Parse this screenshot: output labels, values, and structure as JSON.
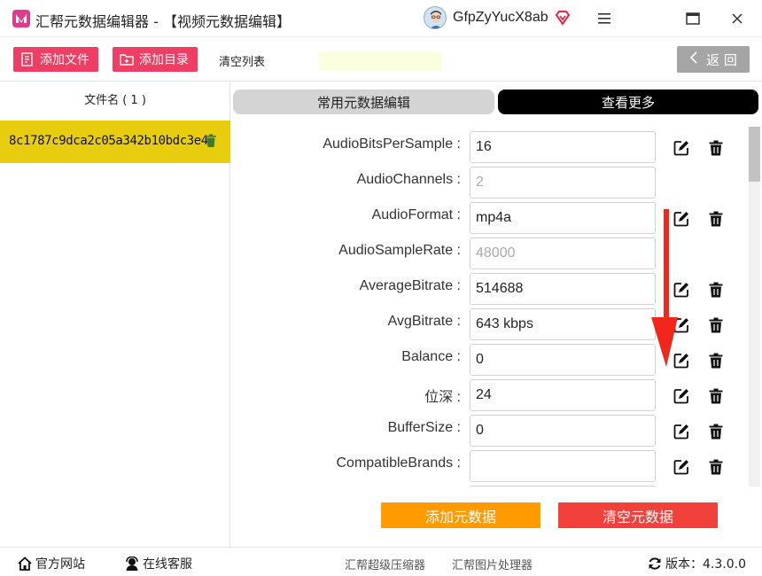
{
  "titlebar": {
    "title": "汇帮元数据编辑器 - 【视频元数据编辑】",
    "username": "GfpZyYucX8ab",
    "menu_icon": "menu-icon",
    "maximize_icon": "maximize-icon",
    "close_icon": "close-icon"
  },
  "toolbar": {
    "add_file": "添加文件",
    "add_dir": "添加目录",
    "clear_list": "清空列表",
    "back": "返 回"
  },
  "file_panel": {
    "header": "文件名 ( 1 )",
    "files": [
      {
        "name": "8c1787c9dca2c05a342b10bdc3e4"
      }
    ]
  },
  "tabs": {
    "common": "常用元数据编辑",
    "more": "查看更多"
  },
  "metadata": [
    {
      "label": "AudioBitsPerSample :",
      "value": "16",
      "editable": true
    },
    {
      "label": "AudioChannels :",
      "value": "2",
      "editable": false
    },
    {
      "label": "AudioFormat :",
      "value": "mp4a",
      "editable": true
    },
    {
      "label": "AudioSampleRate :",
      "value": "48000",
      "editable": false
    },
    {
      "label": "AverageBitrate :",
      "value": "514688",
      "editable": true
    },
    {
      "label": "AvgBitrate :",
      "value": "643 kbps",
      "editable": true
    },
    {
      "label": "Balance :",
      "value": "0",
      "editable": true
    },
    {
      "label": "位深 :",
      "value": "24",
      "editable": true
    },
    {
      "label": "BufferSize :",
      "value": "0",
      "editable": true
    },
    {
      "label": "CompatibleBrands :",
      "value": "",
      "editable": true
    }
  ],
  "actions": {
    "add_meta": "添加元数据",
    "clear_meta": "清空元数据"
  },
  "footer": {
    "website": "官方网站",
    "support": "在线客服",
    "link1": "汇帮超级压缩器",
    "link2": "汇帮图片处理器",
    "version": "版本：4.3.0.0"
  },
  "colors": {
    "accent_pink": "#ef3e63",
    "selected_file": "#e7cd0d",
    "add_meta": "#ff9a00",
    "clear_meta": "#f2413b",
    "back_button": "#a5a5a5"
  }
}
